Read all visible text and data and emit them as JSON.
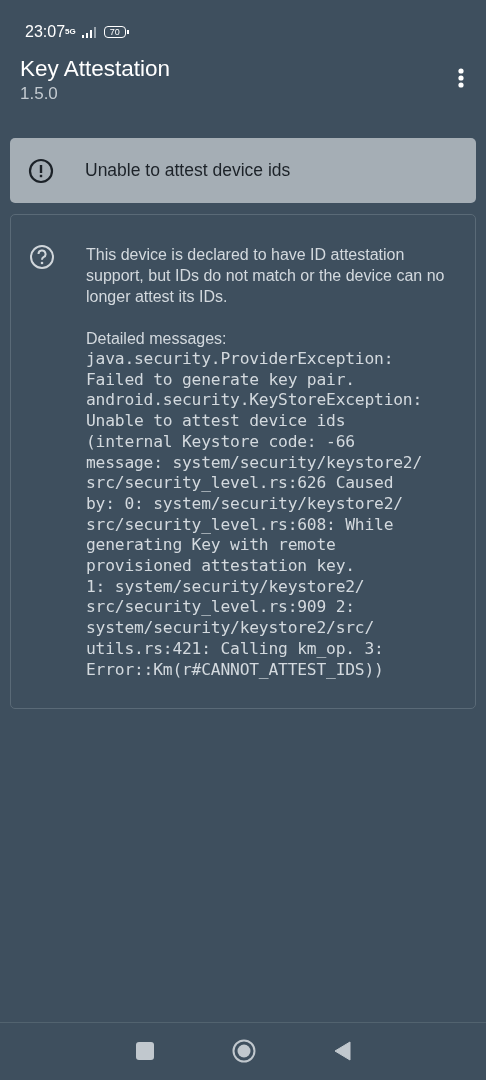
{
  "status_bar": {
    "time": "23:07",
    "network": "5G",
    "battery": "70"
  },
  "app_bar": {
    "title": "Key Attestation",
    "subtitle": "1.5.0"
  },
  "banner": {
    "kind": "error",
    "text": "Unable to attest device ids"
  },
  "detail_card": {
    "kind": "help",
    "description": "This device is declared to have ID attestation support, but IDs do not match or the device can no longer attest its IDs.",
    "heading": "Detailed messages:",
    "message": "java.security.ProviderException:\nFailed to generate key pair.\nandroid.security.KeyStoreException:\nUnable to attest device ids\n(internal Keystore code: -66\nmessage: system/security/keystore2/\nsrc/security_level.rs:626 Caused\nby: 0: system/security/keystore2/\nsrc/security_level.rs:608: While\ngenerating Key with remote\nprovisioned attestation key.\n1: system/security/keystore2/\nsrc/security_level.rs:909 2:\nsystem/security/keystore2/src/\nutils.rs:421: Calling km_op. 3:\nError::Km(r#CANNOT_ATTEST_IDS))"
  }
}
